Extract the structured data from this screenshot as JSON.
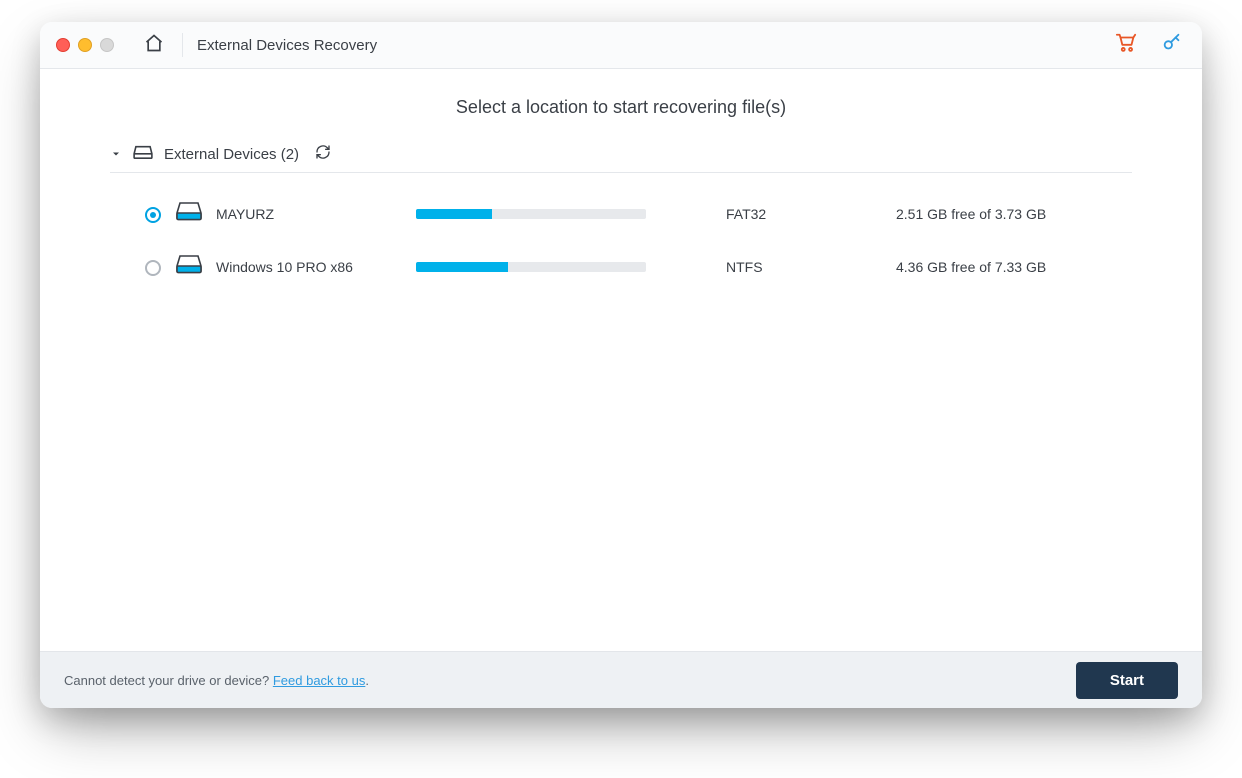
{
  "header": {
    "title": "External Devices Recovery"
  },
  "main": {
    "prompt": "Select a location to start recovering file(s)",
    "group_label": "External Devices (2)"
  },
  "devices": [
    {
      "name": "MAYURZ",
      "fs": "FAT32",
      "free_text": "2.51 GB free of 3.73 GB",
      "used_pct": 33,
      "selected": true
    },
    {
      "name": "Windows 10 PRO x86",
      "fs": "NTFS",
      "free_text": "4.36 GB free of 7.33 GB",
      "used_pct": 40,
      "selected": false
    }
  ],
  "footer": {
    "detect_text": "Cannot detect your drive or device? ",
    "feedback_link": "Feed back to us",
    "period": ".",
    "start_label": "Start"
  }
}
